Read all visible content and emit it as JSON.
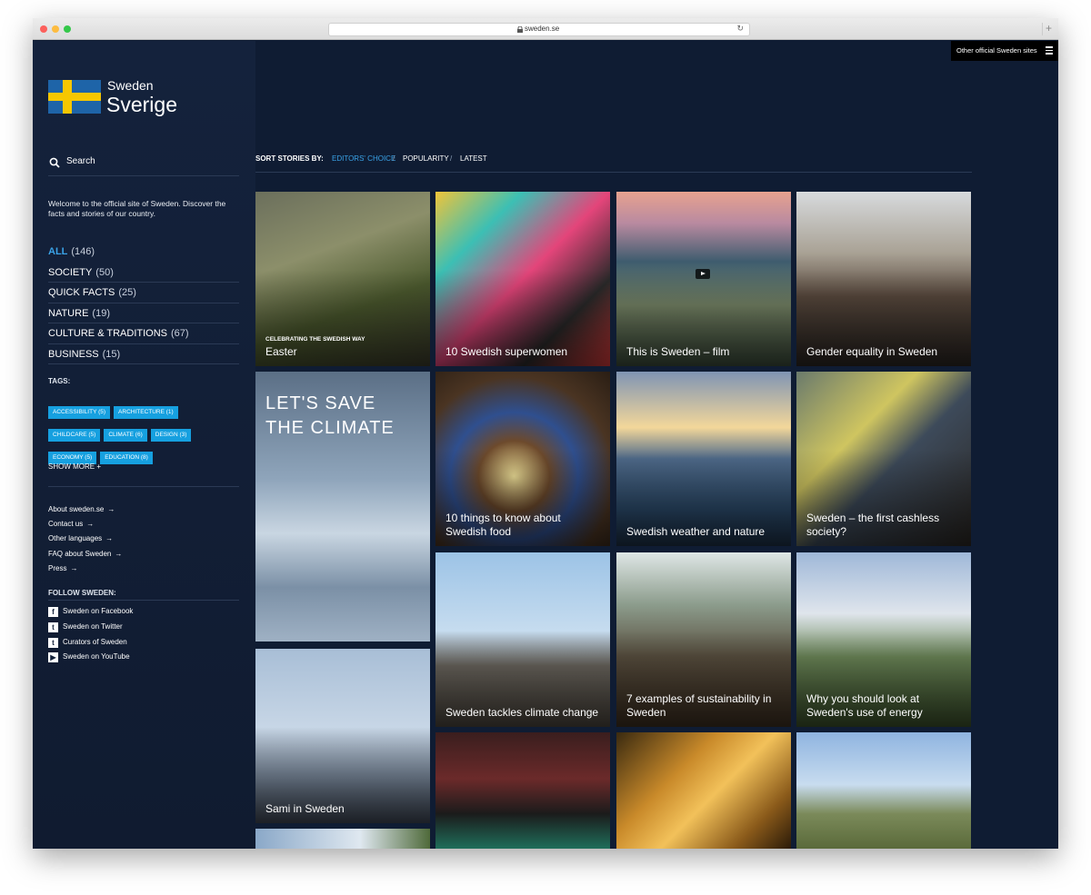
{
  "browser": {
    "url": "sweden.se"
  },
  "header": {
    "other_sites": "Other official Sweden sites"
  },
  "logo": {
    "line1": "Sweden",
    "line2": "Sverige"
  },
  "search": {
    "label": "Search"
  },
  "welcome": "Welcome to the official site of Sweden. Discover the facts and stories of our country.",
  "categories": [
    {
      "name": "ALL",
      "count": "(146)"
    },
    {
      "name": "SOCIETY",
      "count": "(50)"
    },
    {
      "name": "QUICK FACTS",
      "count": "(25)"
    },
    {
      "name": "NATURE",
      "count": "(19)"
    },
    {
      "name": "CULTURE & TRADITIONS",
      "count": "(67)"
    },
    {
      "name": "BUSINESS",
      "count": "(15)"
    }
  ],
  "tags_label": "TAGS:",
  "tags": [
    "ACCESSIBILITY (5)",
    "ARCHITECTURE (1)",
    "CHILDCARE (5)",
    "CLIMATE (6)",
    "DESIGN (3)",
    "ECONOMY (5)",
    "EDUCATION (8)"
  ],
  "show_more": "SHOW MORE +",
  "links": [
    "About sweden.se",
    "Contact us",
    "Other languages",
    "FAQ about Sweden",
    "Press"
  ],
  "follow_label": "FOLLOW SWEDEN:",
  "socials": [
    {
      "icon": "facebook-icon",
      "label": "Sweden on Facebook"
    },
    {
      "icon": "twitter-icon",
      "label": "Sweden on Twitter"
    },
    {
      "icon": "twitter-icon",
      "label": "Curators of Sweden"
    },
    {
      "icon": "youtube-icon",
      "label": "Sweden on YouTube"
    }
  ],
  "sort": {
    "label": "SORT STORIES BY:",
    "options": [
      "EDITORS' CHOICE",
      "POPULARITY",
      "LATEST"
    ],
    "active": "EDITORS' CHOICE"
  },
  "cards": {
    "easter": {
      "kicker": "CELEBRATING THE SWEDISH WAY",
      "title": "Easter"
    },
    "superwomen": {
      "title": "10 Swedish superwomen"
    },
    "film": {
      "title": "This is Sweden – film"
    },
    "gender": {
      "title": "Gender equality in Sweden"
    },
    "climate": {
      "big": "LET'S SAVE THE CLIMATE"
    },
    "food": {
      "title": "10 things to know about Swedish food"
    },
    "weather": {
      "title": "Swedish weather and nature"
    },
    "cashless": {
      "title": "Sweden – the first cashless society?"
    },
    "sami": {
      "title": "Sami in Sweden"
    },
    "tackles": {
      "title": "Sweden tackles climate change"
    },
    "sustain": {
      "title": "7 examples of sustainability in Sweden"
    },
    "energy": {
      "title": "Why you should look at Sweden's use of energy"
    }
  },
  "colors": {
    "page_bg": "#0f1c33",
    "accent": "#3aa3e8",
    "tag_bg": "#16a0e0",
    "flag_blue": "#1e64a8",
    "flag_yellow": "#f6c700"
  }
}
